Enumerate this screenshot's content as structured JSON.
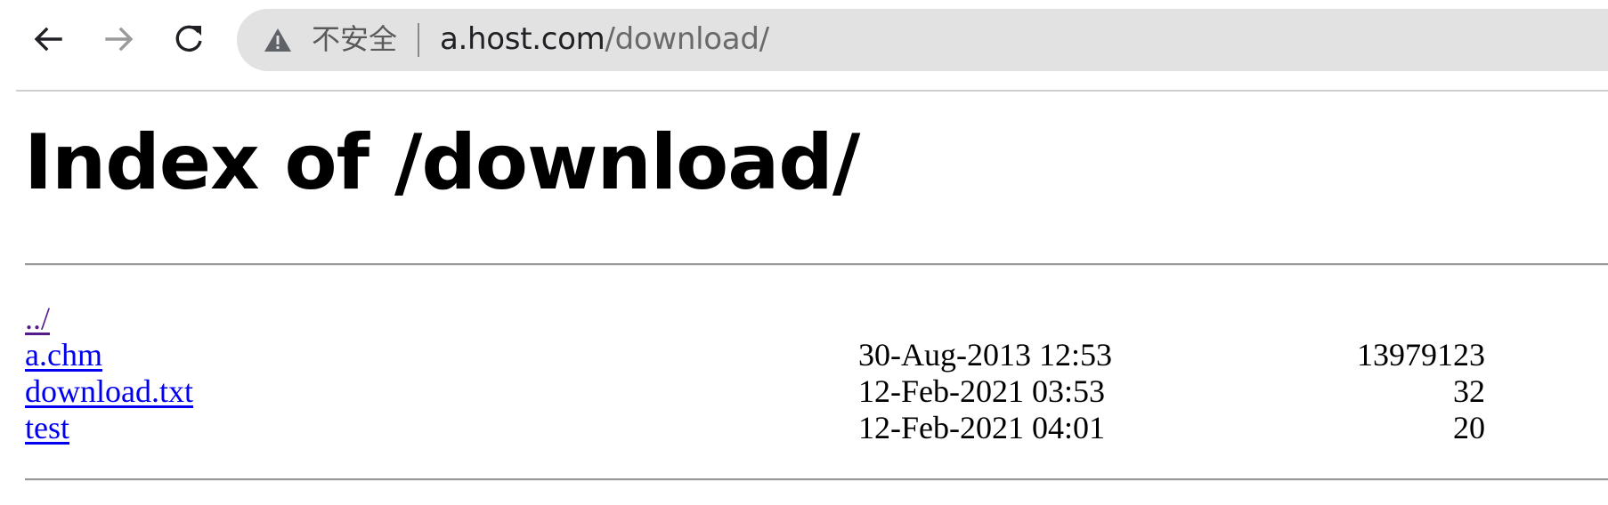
{
  "browser": {
    "back_icon": "arrow-left-icon",
    "forward_icon": "arrow-right-icon",
    "reload_icon": "reload-icon",
    "security_icon": "warning-triangle-icon",
    "security_label": "不安全",
    "url_host": "a.host.com",
    "url_path": "/download/"
  },
  "page": {
    "title": "Index of /download/"
  },
  "listing": {
    "parent_link": "../",
    "entries": [
      {
        "name": "a.chm",
        "date": "30-Aug-2013 12:53",
        "size": "13979123"
      },
      {
        "name": "download.txt",
        "date": "12-Feb-2021 03:53",
        "size": "32"
      },
      {
        "name": "test",
        "date": "12-Feb-2021 04:01",
        "size": "20"
      }
    ]
  },
  "colors": {
    "link": "#0000ee",
    "visited_link": "#551a8b",
    "omnibox_bg": "#e2e2e2"
  }
}
